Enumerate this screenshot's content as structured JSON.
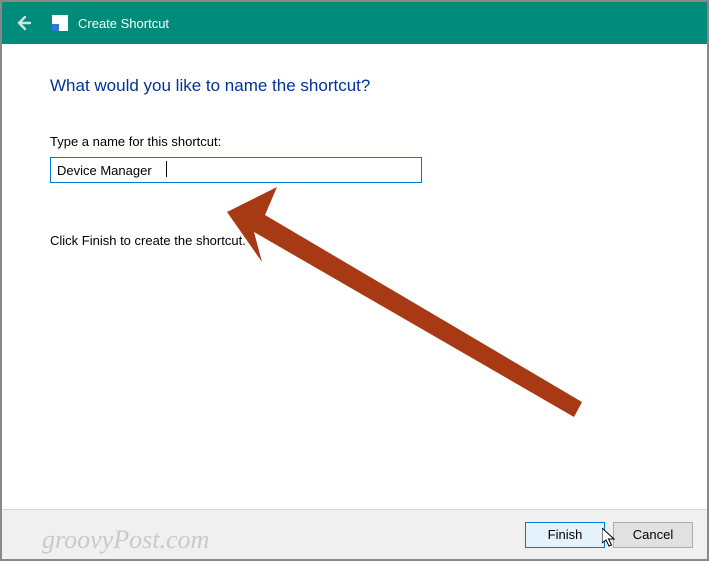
{
  "titlebar": {
    "title": "Create Shortcut"
  },
  "heading": "What would you like to name the shortcut?",
  "input": {
    "label": "Type a name for this shortcut:",
    "value": "Device Manager"
  },
  "help_text": "Click Finish to create the shortcut.",
  "buttons": {
    "finish": "Finish",
    "cancel": "Cancel"
  },
  "watermark": "groovyPost.com",
  "colors": {
    "titlebar_bg": "#008b7a",
    "heading_color": "#003399",
    "input_border": "#0078d7",
    "annotation_arrow": "#a73a14"
  }
}
